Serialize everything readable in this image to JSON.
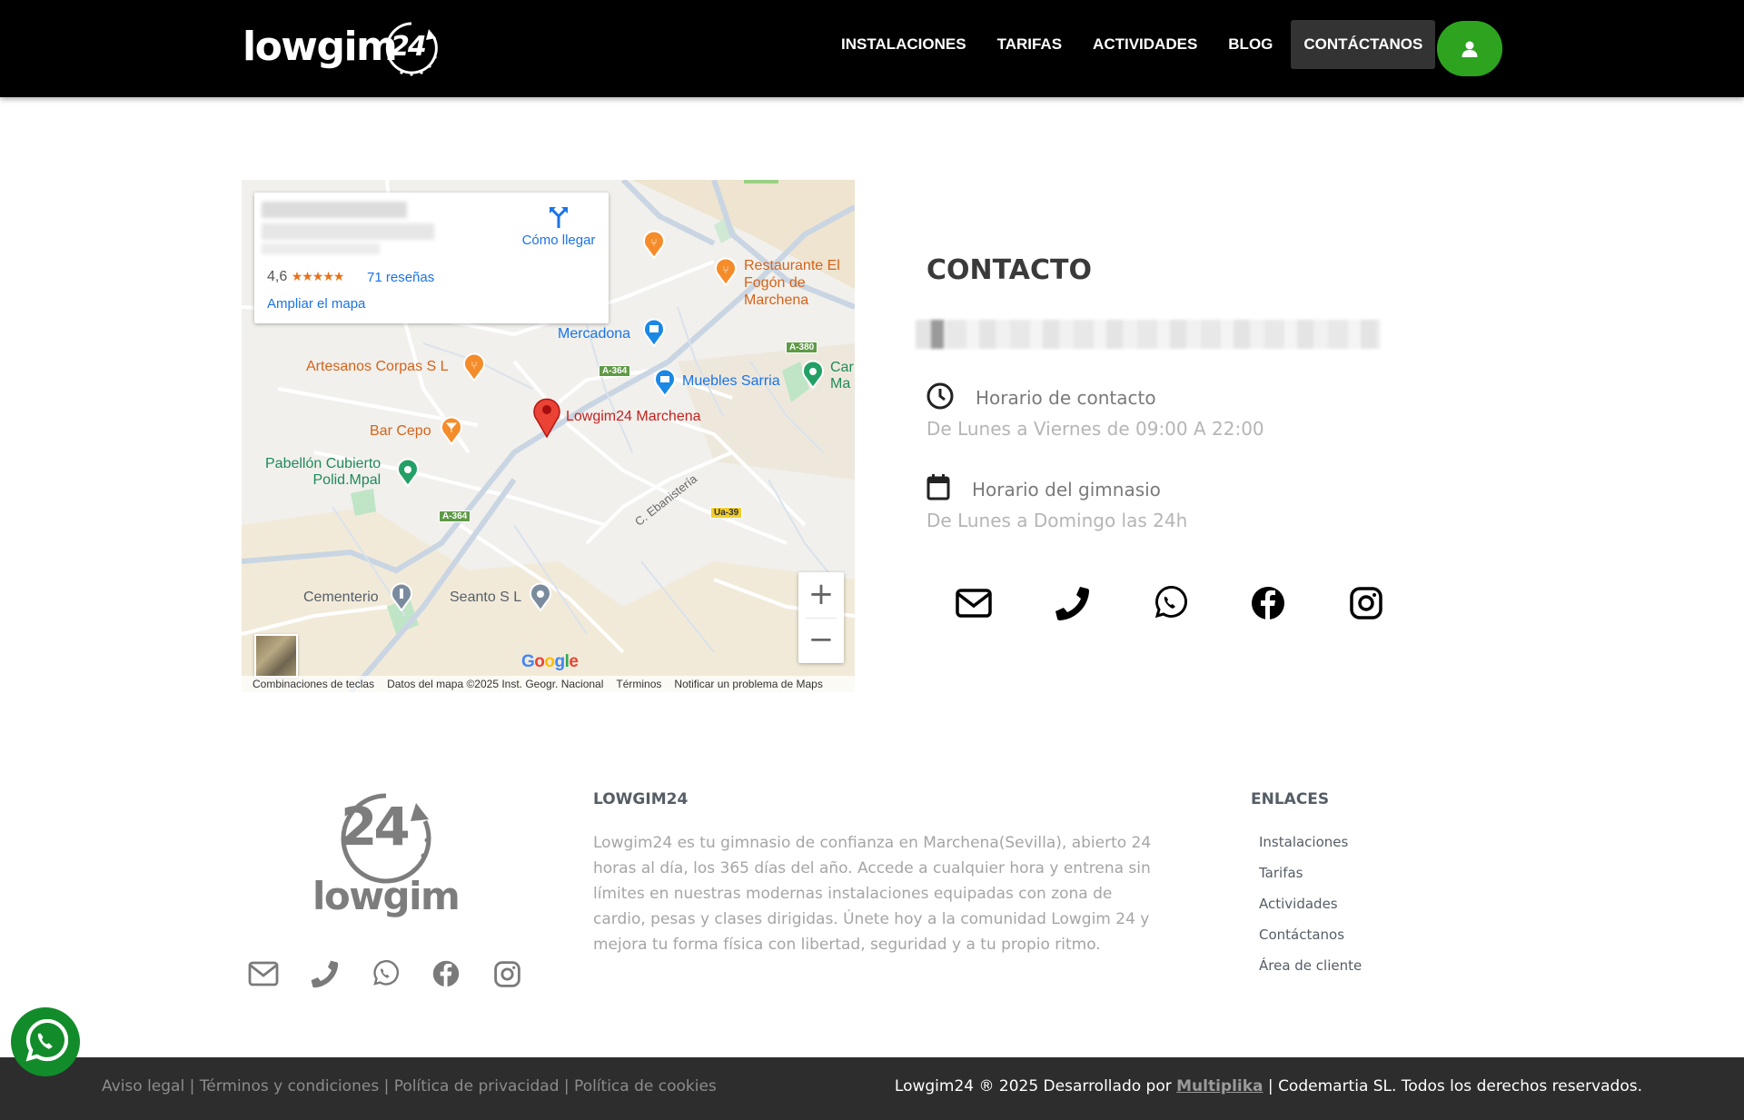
{
  "header": {
    "logo_word": "lowgim",
    "logo_number": "24",
    "nav": [
      {
        "label": "INSTALACIONES"
      },
      {
        "label": "TARIFAS"
      },
      {
        "label": "ACTIVIDADES"
      },
      {
        "label": "BLOG"
      },
      {
        "label": "CONTÁCTANOS"
      }
    ],
    "user_icon": "user-icon",
    "accent": "#2ea31f"
  },
  "map": {
    "card": {
      "rating": "4,6",
      "stars": "★★★★★",
      "reviews": "71 reseñas",
      "enlarge": "Ampliar el mapa",
      "directions": "Cómo llegar"
    },
    "places": {
      "restaurante": "Restaurante El Fogón de Marchena",
      "mercadona": "Mercadona",
      "artesanos": "Artesanos Corpas S L",
      "muebles": "Muebles Sarria",
      "lowgim": "Lowgim24 Marchena",
      "barcepo": "Bar Cepo",
      "pabellon1": "Pabellón Cubierto",
      "pabellon2": "Polid.Mpal",
      "cementerio": "Cementerio",
      "seanto": "Seanto S L",
      "ebanisteria": "C. Ebanistería",
      "car1": "Car",
      "car2": "Ma"
    },
    "road_labels": {
      "a364a": "A-364",
      "a364b": "A-364",
      "a380": "A-380",
      "ua39": "Ua-39"
    },
    "zoom_in": "+",
    "zoom_out": "−",
    "google": "Google",
    "footer": {
      "shortcuts": "Combinaciones de teclas",
      "data": "Datos del mapa ©2025 Inst. Geogr. Nacional",
      "terms": "Términos",
      "report": "Notificar un problema de Maps"
    }
  },
  "contact": {
    "title": "CONTACTO",
    "contact_hours_title": "Horario de contacto",
    "contact_hours_value": "De Lunes a Viernes de 09:00 A 22:00",
    "gym_hours_title": "Horario del gimnasio",
    "gym_hours_value": "De Lunes a Domingo las 24h",
    "social_icons": [
      "envelope-icon",
      "phone-icon",
      "whatsapp-icon",
      "facebook-icon",
      "instagram-icon"
    ]
  },
  "footer": {
    "logo_number": "24",
    "logo_word": "lowgim",
    "about_title": "LOWGIM24",
    "about_text": "Lowgim24 es tu gimnasio de confianza en Marchena(Sevilla), abierto 24 horas al día, los 365 días del año. Accede a cualquier hora y entrena sin límites en nuestras modernas instalaciones equipadas con zona de cardio, pesas y clases dirigidas. Únete hoy a la comunidad Lowgim 24 y mejora tu forma física con libertad, seguridad y a tu propio ritmo.",
    "links_title": "ENLACES",
    "links": [
      "Instalaciones",
      "Tarifas",
      "Actividades",
      "Contáctanos",
      "Área de cliente"
    ],
    "legal": {
      "aviso": "Aviso legal",
      "terminos": "Términos y condiciones",
      "privacidad": "Política de privacidad",
      "cookies": "Política de cookies",
      "sep": " | "
    },
    "copyright_prefix": "Lowgim24 ® 2025 Desarrollado por ",
    "copyright_link": "Multiplika",
    "copyright_suffix": " | Codemartia SL. Todos los derechos reservados."
  }
}
